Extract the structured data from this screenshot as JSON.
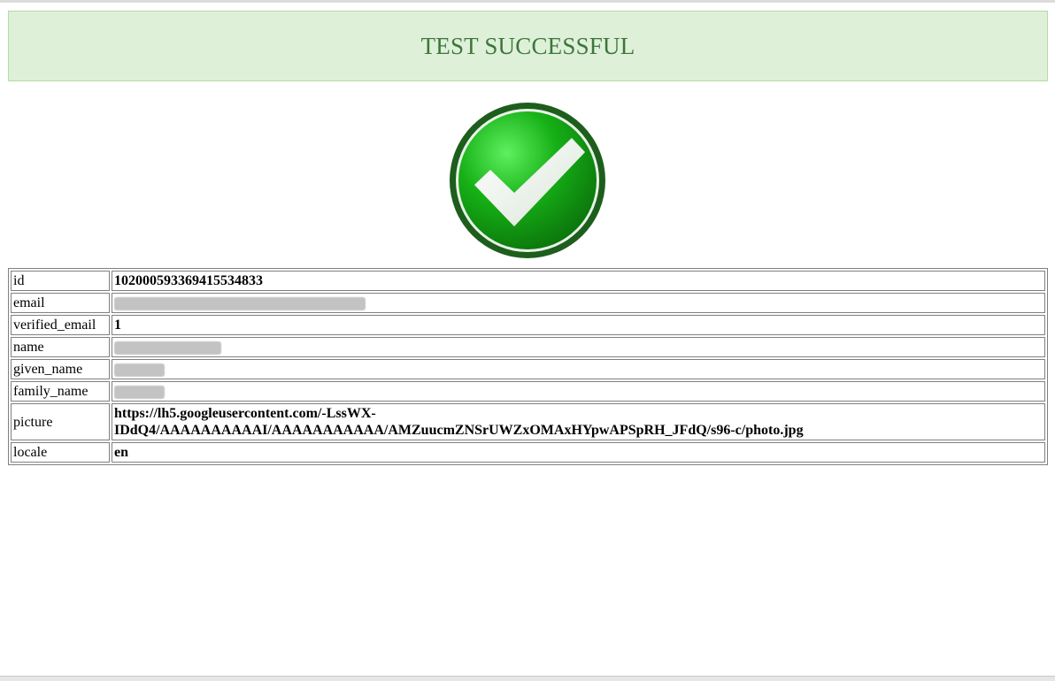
{
  "banner": {
    "title": "TEST SUCCESSFUL"
  },
  "status_icon": "checkmark-success-icon",
  "colors": {
    "banner_bg": "#dff0d8",
    "banner_text": "#3c763d",
    "check_green": "#1aa31a"
  },
  "details": {
    "rows": [
      {
        "key": "id",
        "value": "102000593369415534833"
      },
      {
        "key": "email",
        "value": "",
        "redacted": true
      },
      {
        "key": "verified_email",
        "value": "1"
      },
      {
        "key": "name",
        "value": "",
        "redacted": true
      },
      {
        "key": "given_name",
        "value": "",
        "redacted": true
      },
      {
        "key": "family_name",
        "value": "",
        "redacted": true
      },
      {
        "key": "picture",
        "value": "https://lh5.googleusercontent.com/-LssWX-IDdQ4/AAAAAAAAAAI/AAAAAAAAAAA/AMZuucmZNSrUWZxOMAxHYpwAPSpRH_JFdQ/s96-c/photo.jpg"
      },
      {
        "key": "locale",
        "value": "en"
      }
    ]
  }
}
